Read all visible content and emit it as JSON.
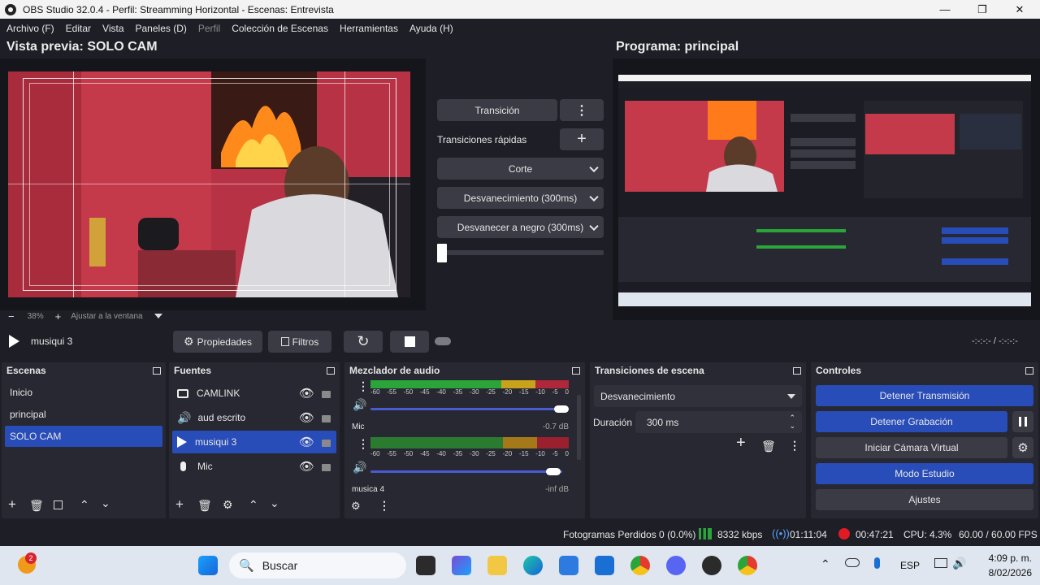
{
  "window": {
    "title": "OBS Studio 32.0.4 - Perfil: Streamming Horizontal - Escenas: Entrevista"
  },
  "menu": [
    "Archivo (F)",
    "Editar",
    "Vista",
    "Paneles (D)",
    "Perfil",
    "Colección de Escenas",
    "Herramientas",
    "Ayuda (H)"
  ],
  "preview": {
    "title": "Vista previa: SOLO CAM",
    "zoom_minus": "−",
    "zoom": "38%",
    "zoom_plus": "+",
    "fit": "Ajustar a la ventana"
  },
  "program": {
    "title": "Programa: principal"
  },
  "transitions_panel": {
    "transition_btn": "Transición",
    "quick_label": "Transiciones rápidas",
    "items": [
      "Corte",
      "Desvanecimiento (300ms)",
      "Desvanecer a negro (300ms)"
    ]
  },
  "media_bar": {
    "source": "musiqui 3",
    "properties": "Propiedades",
    "filters": "Filtros",
    "time": "-:-:-:-  /  -:-:-:-"
  },
  "scenes": {
    "title": "Escenas",
    "items": [
      "Inicio",
      "principal",
      "SOLO CAM"
    ],
    "selected_index": 2
  },
  "sources": {
    "title": "Fuentes",
    "items": [
      {
        "name": "CAMLINK",
        "icon": "camera-icon"
      },
      {
        "name": "aud escrito",
        "icon": "speaker-icon"
      },
      {
        "name": "musiqui 3",
        "icon": "play-icon"
      },
      {
        "name": "Mic",
        "icon": "microphone-icon"
      }
    ],
    "selected_index": 2
  },
  "mixer": {
    "title": "Mezclador de audio",
    "scale": [
      "-60",
      "-55",
      "-50",
      "-45",
      "-40",
      "-35",
      "-30",
      "-25",
      "-20",
      "-15",
      "-10",
      "-5",
      "0"
    ],
    "channels": [
      {
        "name": "",
        "level": ""
      },
      {
        "name": "Mic",
        "level": "-0.7 dB"
      },
      {
        "name": "musica 4",
        "level": "-inf dB"
      }
    ]
  },
  "scene_transitions": {
    "title": "Transiciones de escena",
    "selected": "Desvanecimiento",
    "duration_label": "Duración",
    "duration_value": "300 ms"
  },
  "controls": {
    "title": "Controles",
    "stop_stream": "Detener Transmisión",
    "stop_record": "Detener Grabación",
    "virtual_cam": "Iniciar Cámara Virtual",
    "studio_mode": "Modo Estudio",
    "settings": "Ajustes"
  },
  "status": {
    "dropped": "Fotogramas Perdidos 0 (0.0%)",
    "bitrate": "8332 kbps",
    "stream_time": "01:11:04",
    "rec_time": "00:47:21",
    "cpu": "CPU: 4.3%",
    "fps": "60.00 / 60.00 FPS"
  },
  "taskbar": {
    "search": "Buscar",
    "badge": "2",
    "lang": "ESP",
    "time": "4:09 p. m.",
    "date": "8/02/2026"
  },
  "colors": {
    "accent": "#284cb8",
    "panel": "#272831",
    "bg": "#1e1f26"
  }
}
